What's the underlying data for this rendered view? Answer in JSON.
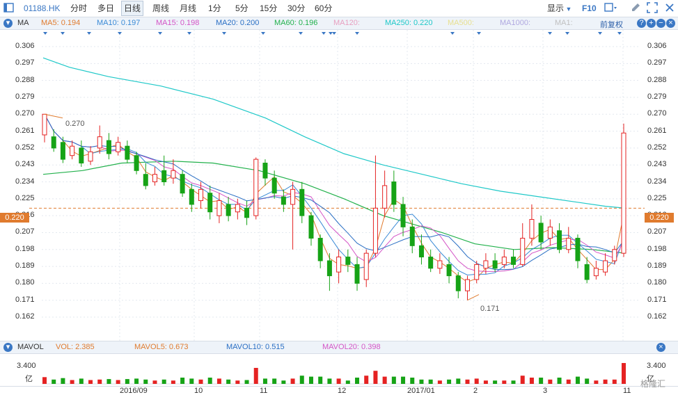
{
  "toolbar": {
    "code": "01188.HK",
    "periods": [
      "分时",
      "多日",
      "日线",
      "周线",
      "月线",
      "1分",
      "5分",
      "15分",
      "30分",
      "60分"
    ],
    "active": "日线",
    "display": "显示",
    "f10": "F10"
  },
  "ma_bar": {
    "collapse_icon": "chevron-down-icon",
    "label": "MA",
    "items": [
      {
        "text": "MA5: 0.194",
        "color": "#e07b2e"
      },
      {
        "text": "MA10: 0.197",
        "color": "#3a8ad6"
      },
      {
        "text": "MA15: 0.198",
        "color": "#d454c6"
      },
      {
        "text": "MA20: 0.200",
        "color": "#2a6fc4"
      },
      {
        "text": "MA60: 0.196",
        "color": "#22b14c"
      },
      {
        "text": "MA120:",
        "color": "#e8a0c0"
      },
      {
        "text": "MA250: 0.220",
        "color": "#1ec8c8"
      },
      {
        "text": "MA500:",
        "color": "#e8e090"
      },
      {
        "text": "MA1000:",
        "color": "#b0a8e0"
      },
      {
        "text": "MA1:",
        "color": "#c0c0c0"
      }
    ],
    "restore_label": "前复权"
  },
  "price_axis": {
    "ticks": [
      "0.306",
      "0.297",
      "0.288",
      "0.279",
      "0.270",
      "0.261",
      "0.252",
      "0.243",
      "0.234",
      "0.225",
      "0.216",
      "0.207",
      "0.198",
      "0.189",
      "0.180",
      "0.171",
      "0.162"
    ],
    "current": "0.220",
    "current_color": "#e07b2e"
  },
  "annotations": {
    "high": "0.270",
    "low": "0.171"
  },
  "vol_bar": {
    "label": "MAVOL",
    "items": [
      {
        "text": "VOL: 2.385",
        "color": "#e07b2e"
      },
      {
        "text": "MAVOL5: 0.673",
        "color": "#e07b2e"
      },
      {
        "text": "MAVOL10: 0.515",
        "color": "#2a6fc4"
      },
      {
        "text": "MAVOL20: 0.398",
        "color": "#d454c6"
      }
    ],
    "axis_value": "3.400",
    "axis_unit": "亿"
  },
  "time_axis": [
    "2016/09",
    "10",
    "11",
    "12",
    "2017/01",
    "2",
    "3",
    "11"
  ],
  "watermark": "格隆汇",
  "colors": {
    "up": "#e52222",
    "down": "#16a316",
    "ma250": "#1ec8c8",
    "ma60": "#22b14c"
  },
  "chart_data": {
    "type": "candlestick",
    "y_range": [
      0.162,
      0.306
    ],
    "grid": true,
    "series_ma250": [
      [
        0,
        0.3
      ],
      [
        40,
        0.295
      ],
      [
        100,
        0.29
      ],
      [
        180,
        0.285
      ],
      [
        260,
        0.278
      ],
      [
        340,
        0.268
      ],
      [
        400,
        0.258
      ],
      [
        460,
        0.249
      ],
      [
        520,
        0.243
      ],
      [
        580,
        0.238
      ],
      [
        640,
        0.233
      ],
      [
        700,
        0.229
      ],
      [
        760,
        0.226
      ],
      [
        820,
        0.223
      ],
      [
        860,
        0.221
      ],
      [
        890,
        0.22
      ]
    ],
    "series_ma60": [
      [
        0,
        0.238
      ],
      [
        60,
        0.24
      ],
      [
        120,
        0.244
      ],
      [
        200,
        0.245
      ],
      [
        260,
        0.244
      ],
      [
        330,
        0.24
      ],
      [
        400,
        0.233
      ],
      [
        460,
        0.225
      ],
      [
        520,
        0.216
      ],
      [
        560,
        0.212
      ],
      [
        610,
        0.207
      ],
      [
        660,
        0.201
      ],
      [
        720,
        0.198
      ],
      [
        780,
        0.199
      ],
      [
        840,
        0.198
      ],
      [
        890,
        0.196
      ]
    ],
    "candles": [
      {
        "t": 0,
        "o": 0.259,
        "c": 0.27,
        "h": 0.27,
        "l": 0.255
      },
      {
        "t": 1,
        "o": 0.258,
        "c": 0.252,
        "h": 0.262,
        "l": 0.25
      },
      {
        "t": 2,
        "o": 0.255,
        "c": 0.246,
        "h": 0.258,
        "l": 0.244
      },
      {
        "t": 3,
        "o": 0.248,
        "c": 0.253,
        "h": 0.256,
        "l": 0.246
      },
      {
        "t": 4,
        "o": 0.252,
        "c": 0.244,
        "h": 0.256,
        "l": 0.242
      },
      {
        "t": 5,
        "o": 0.245,
        "c": 0.25,
        "h": 0.253,
        "l": 0.243
      },
      {
        "t": 6,
        "o": 0.252,
        "c": 0.258,
        "h": 0.264,
        "l": 0.249
      },
      {
        "t": 7,
        "o": 0.256,
        "c": 0.249,
        "h": 0.26,
        "l": 0.246
      },
      {
        "t": 8,
        "o": 0.25,
        "c": 0.255,
        "h": 0.258,
        "l": 0.248
      },
      {
        "t": 9,
        "o": 0.253,
        "c": 0.246,
        "h": 0.256,
        "l": 0.244
      },
      {
        "t": 10,
        "o": 0.248,
        "c": 0.24,
        "h": 0.25,
        "l": 0.238
      },
      {
        "t": 11,
        "o": 0.238,
        "c": 0.232,
        "h": 0.244,
        "l": 0.23
      },
      {
        "t": 12,
        "o": 0.234,
        "c": 0.238,
        "h": 0.242,
        "l": 0.232
      },
      {
        "t": 13,
        "o": 0.24,
        "c": 0.234,
        "h": 0.248,
        "l": 0.232
      },
      {
        "t": 14,
        "o": 0.236,
        "c": 0.24,
        "h": 0.246,
        "l": 0.233
      },
      {
        "t": 15,
        "o": 0.238,
        "c": 0.228,
        "h": 0.24,
        "l": 0.226
      },
      {
        "t": 16,
        "o": 0.23,
        "c": 0.222,
        "h": 0.233,
        "l": 0.218
      },
      {
        "t": 17,
        "o": 0.224,
        "c": 0.23,
        "h": 0.234,
        "l": 0.22
      },
      {
        "t": 18,
        "o": 0.228,
        "c": 0.218,
        "h": 0.232,
        "l": 0.214
      },
      {
        "t": 19,
        "o": 0.216,
        "c": 0.224,
        "h": 0.228,
        "l": 0.212
      },
      {
        "t": 20,
        "o": 0.222,
        "c": 0.216,
        "h": 0.226,
        "l": 0.213
      },
      {
        "t": 21,
        "o": 0.218,
        "c": 0.222,
        "h": 0.225,
        "l": 0.214
      },
      {
        "t": 22,
        "o": 0.22,
        "c": 0.215,
        "h": 0.224,
        "l": 0.211
      },
      {
        "t": 23,
        "o": 0.216,
        "c": 0.246,
        "h": 0.247,
        "l": 0.214
      },
      {
        "t": 24,
        "o": 0.244,
        "c": 0.236,
        "h": 0.246,
        "l": 0.232
      },
      {
        "t": 25,
        "o": 0.236,
        "c": 0.228,
        "h": 0.24,
        "l": 0.225
      },
      {
        "t": 26,
        "o": 0.226,
        "c": 0.222,
        "h": 0.23,
        "l": 0.218
      },
      {
        "t": 27,
        "o": 0.222,
        "c": 0.23,
        "h": 0.234,
        "l": 0.198
      },
      {
        "t": 28,
        "o": 0.23,
        "c": 0.216,
        "h": 0.234,
        "l": 0.212
      },
      {
        "t": 29,
        "o": 0.216,
        "c": 0.204,
        "h": 0.218,
        "l": 0.2
      },
      {
        "t": 30,
        "o": 0.204,
        "c": 0.192,
        "h": 0.206,
        "l": 0.188
      },
      {
        "t": 31,
        "o": 0.192,
        "c": 0.184,
        "h": 0.196,
        "l": 0.176
      },
      {
        "t": 32,
        "o": 0.186,
        "c": 0.194,
        "h": 0.198,
        "l": 0.18
      },
      {
        "t": 33,
        "o": 0.194,
        "c": 0.19,
        "h": 0.198,
        "l": 0.186
      },
      {
        "t": 34,
        "o": 0.19,
        "c": 0.18,
        "h": 0.194,
        "l": 0.176
      },
      {
        "t": 35,
        "o": 0.182,
        "c": 0.196,
        "h": 0.198,
        "l": 0.178
      },
      {
        "t": 36,
        "o": 0.196,
        "c": 0.22,
        "h": 0.248,
        "l": 0.194
      },
      {
        "t": 37,
        "o": 0.22,
        "c": 0.232,
        "h": 0.24,
        "l": 0.215
      },
      {
        "t": 38,
        "o": 0.234,
        "c": 0.222,
        "h": 0.24,
        "l": 0.218
      },
      {
        "t": 39,
        "o": 0.222,
        "c": 0.21,
        "h": 0.226,
        "l": 0.205
      },
      {
        "t": 40,
        "o": 0.21,
        "c": 0.2,
        "h": 0.214,
        "l": 0.196
      },
      {
        "t": 41,
        "o": 0.2,
        "c": 0.194,
        "h": 0.206,
        "l": 0.19
      },
      {
        "t": 42,
        "o": 0.194,
        "c": 0.188,
        "h": 0.198,
        "l": 0.186
      },
      {
        "t": 43,
        "o": 0.188,
        "c": 0.192,
        "h": 0.196,
        "l": 0.185
      },
      {
        "t": 44,
        "o": 0.19,
        "c": 0.184,
        "h": 0.194,
        "l": 0.18
      },
      {
        "t": 45,
        "o": 0.184,
        "c": 0.176,
        "h": 0.186,
        "l": 0.172
      },
      {
        "t": 46,
        "o": 0.176,
        "c": 0.182,
        "h": 0.184,
        "l": 0.171
      },
      {
        "t": 47,
        "o": 0.182,
        "c": 0.19,
        "h": 0.192,
        "l": 0.18
      },
      {
        "t": 48,
        "o": 0.188,
        "c": 0.192,
        "h": 0.196,
        "l": 0.185
      },
      {
        "t": 49,
        "o": 0.192,
        "c": 0.188,
        "h": 0.196,
        "l": 0.186
      },
      {
        "t": 50,
        "o": 0.19,
        "c": 0.194,
        "h": 0.198,
        "l": 0.188
      },
      {
        "t": 51,
        "o": 0.194,
        "c": 0.19,
        "h": 0.198,
        "l": 0.188
      },
      {
        "t": 52,
        "o": 0.19,
        "c": 0.204,
        "h": 0.212,
        "l": 0.189
      },
      {
        "t": 53,
        "o": 0.204,
        "c": 0.214,
        "h": 0.222,
        "l": 0.2
      },
      {
        "t": 54,
        "o": 0.212,
        "c": 0.202,
        "h": 0.216,
        "l": 0.198
      },
      {
        "t": 55,
        "o": 0.204,
        "c": 0.21,
        "h": 0.214,
        "l": 0.2
      },
      {
        "t": 56,
        "o": 0.208,
        "c": 0.198,
        "h": 0.212,
        "l": 0.196
      },
      {
        "t": 57,
        "o": 0.198,
        "c": 0.204,
        "h": 0.21,
        "l": 0.196
      },
      {
        "t": 58,
        "o": 0.204,
        "c": 0.192,
        "h": 0.206,
        "l": 0.188
      },
      {
        "t": 59,
        "o": 0.19,
        "c": 0.182,
        "h": 0.194,
        "l": 0.18
      },
      {
        "t": 60,
        "o": 0.184,
        "c": 0.188,
        "h": 0.192,
        "l": 0.182
      },
      {
        "t": 61,
        "o": 0.186,
        "c": 0.192,
        "h": 0.196,
        "l": 0.184
      },
      {
        "t": 62,
        "o": 0.192,
        "c": 0.198,
        "h": 0.2,
        "l": 0.19
      },
      {
        "t": 63,
        "o": 0.196,
        "c": 0.26,
        "h": 0.265,
        "l": 0.194
      }
    ],
    "volume": {
      "axis_max": 3.4,
      "unit": "亿",
      "latest": 2.385
    }
  }
}
